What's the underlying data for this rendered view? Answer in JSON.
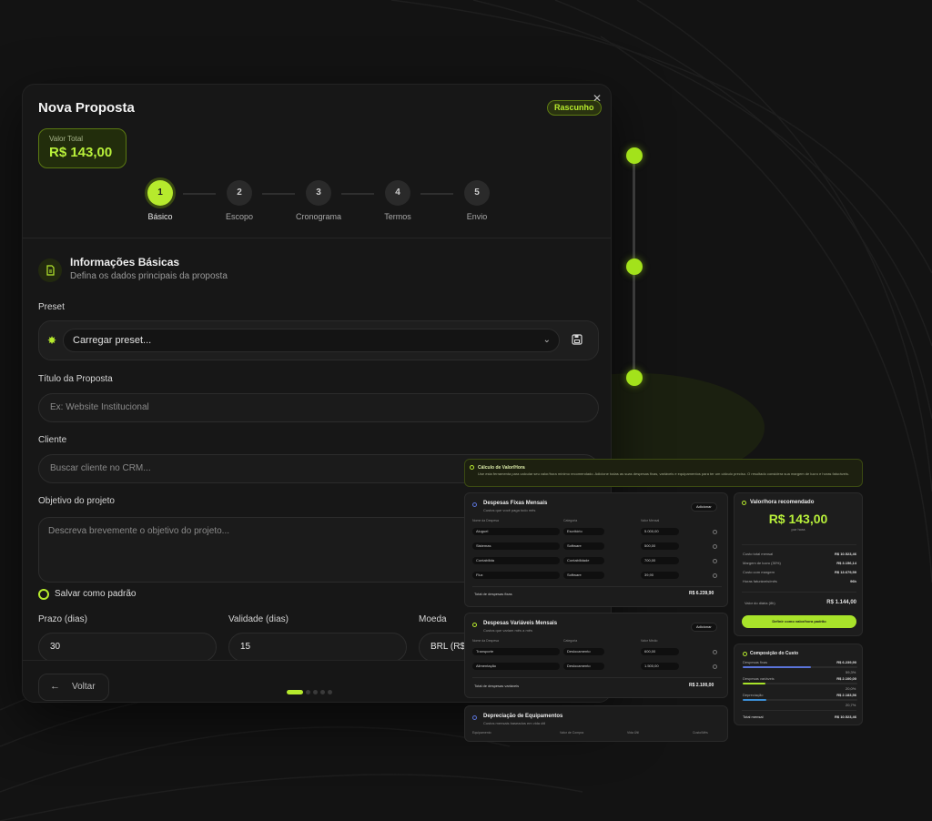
{
  "modal": {
    "title": "Nova Proposta",
    "status_badge": "Rascunho",
    "close_glyph": "✕",
    "total_label": "Valor Total",
    "total_value": "R$ 143,00",
    "steps": [
      {
        "number": "1",
        "label": "Básico",
        "active": true
      },
      {
        "number": "2",
        "label": "Escopo",
        "active": false
      },
      {
        "number": "3",
        "label": "Cronograma",
        "active": false
      },
      {
        "number": "4",
        "label": "Termos",
        "active": false
      },
      {
        "number": "5",
        "label": "Envio",
        "active": false
      }
    ],
    "section": {
      "title": "Informações Básicas",
      "subtitle": "Defina os dados principais da proposta",
      "icon": "document-icon"
    },
    "preset": {
      "label": "Preset",
      "value": "Carregar preset..."
    },
    "proposal_title": {
      "label": "Título da Proposta",
      "placeholder": "Ex: Website Institucional"
    },
    "client": {
      "label": "Cliente",
      "placeholder": "Buscar cliente no CRM..."
    },
    "objective": {
      "label": "Objetivo do projeto",
      "placeholder": "Descreva brevemente o objetivo do projeto..."
    },
    "save_default": "Salvar como padrão",
    "deadline": {
      "label": "Prazo (dias)",
      "value": "30"
    },
    "validity": {
      "label": "Validade (dias)",
      "value": "15"
    },
    "currency": {
      "label": "Moeda",
      "value": "BRL (R$"
    },
    "back_label": "Voltar",
    "page_dots": {
      "count": 5,
      "active_index": 0
    }
  },
  "colors": {
    "accent": "#b6ea2d",
    "background": "#131313",
    "card": "#171717"
  },
  "dashboard": {
    "banner": {
      "title": "Cálculo de Valor/Hora",
      "description": "Use esta ferramenta para calcular seu valor/hora mínimo recomendado. Adicione todas as suas despesas fixas, variáveis e equipamentos para ter um cálculo preciso. O resultado considera sua margem de lucro e horas faturáveis."
    },
    "fixed": {
      "title": "Despesas Fixas Mensais",
      "subtitle": "Custos que você paga todo mês",
      "add": "Adicionar",
      "headers": [
        "Nome da Despesa",
        "Categoria",
        "Valor Mensal"
      ],
      "rows": [
        {
          "name": "Aluguel",
          "category": "Escritório",
          "value": "5.000,00"
        },
        {
          "name": "Sistemas",
          "category": "Software",
          "value": "500,00"
        },
        {
          "name": "Contabilida",
          "category": "Contabilidade",
          "value": "700,00"
        },
        {
          "name": "Flux",
          "category": "Software",
          "value": "39,90"
        }
      ],
      "total_label": "Total de despesas fixas",
      "total_value": "R$ 6.239,90"
    },
    "variable": {
      "title": "Despesas Variáveis Mensais",
      "subtitle": "Custos que variam mês a mês",
      "add": "Adicionar",
      "headers": [
        "Nome da Despesa",
        "Categoria",
        "Valor Médio"
      ],
      "rows": [
        {
          "name": "Transporte",
          "category": "Deslocamento",
          "value": "600,00"
        },
        {
          "name": "Alimentação",
          "category": "Deslocamento",
          "value": "1.500,00"
        }
      ],
      "total_label": "Total de despesas variáveis",
      "total_value": "R$ 2.100,00"
    },
    "equipment": {
      "title": "Depreciação de Equipamentos",
      "subtitle": "Custos mensais baseados em vida útil",
      "headers": [
        "Equipamento",
        "Valor de Compra",
        "Vida Útil",
        "Custo/Mês"
      ]
    },
    "recommended": {
      "title": "Valor/hora recomendado",
      "value": "R$ 143,00",
      "per": "por hora",
      "rows": [
        {
          "label": "Custo total mensal",
          "value": "R$ 10.523,46"
        },
        {
          "label": "Margem de lucro (30%)",
          "value": "R$ 3.156,14"
        },
        {
          "label": "Custo com margem",
          "value": "R$ 13.679,59"
        },
        {
          "label": "Horas faturáveis/mês",
          "value": "96h"
        }
      ],
      "daily_label": "Valor do diária (8h)",
      "daily_value": "R$ 1.144,00",
      "button": "Definir como valor/hora padrão"
    },
    "composition": {
      "title": "Composição do Custo",
      "items": [
        {
          "label": "Despesas fixas",
          "value": "R$ 6.239,90",
          "percent_label": "59,3%",
          "fraction": 0.593,
          "color": "#5a73d8"
        },
        {
          "label": "Despesas variáveis",
          "value": "R$ 2.100,00",
          "percent_label": "20,0%",
          "fraction": 0.2,
          "color": "#a8e32a"
        },
        {
          "label": "Depreciação",
          "value": "R$ 2.183,56",
          "percent_label": "20,7%",
          "fraction": 0.207,
          "color": "#3d8fd6"
        }
      ],
      "total_label": "Total mensal",
      "total_value": "R$ 10.523,46"
    }
  }
}
